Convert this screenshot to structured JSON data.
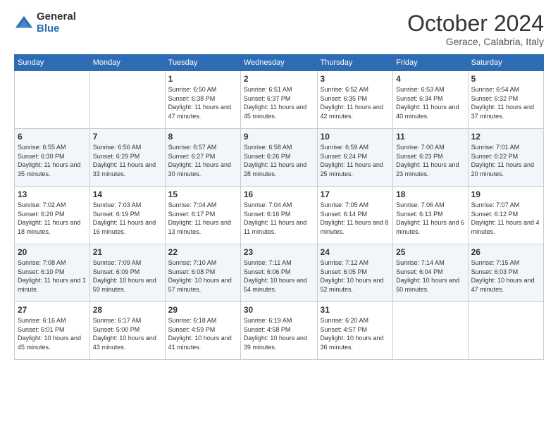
{
  "logo": {
    "general": "General",
    "blue": "Blue"
  },
  "header": {
    "month": "October 2024",
    "location": "Gerace, Calabria, Italy"
  },
  "weekdays": [
    "Sunday",
    "Monday",
    "Tuesday",
    "Wednesday",
    "Thursday",
    "Friday",
    "Saturday"
  ],
  "weeks": [
    [
      {
        "day": "",
        "sunrise": "",
        "sunset": "",
        "daylight": ""
      },
      {
        "day": "",
        "sunrise": "",
        "sunset": "",
        "daylight": ""
      },
      {
        "day": "1",
        "sunrise": "Sunrise: 6:50 AM",
        "sunset": "Sunset: 6:38 PM",
        "daylight": "Daylight: 11 hours and 47 minutes."
      },
      {
        "day": "2",
        "sunrise": "Sunrise: 6:51 AM",
        "sunset": "Sunset: 6:37 PM",
        "daylight": "Daylight: 11 hours and 45 minutes."
      },
      {
        "day": "3",
        "sunrise": "Sunrise: 6:52 AM",
        "sunset": "Sunset: 6:35 PM",
        "daylight": "Daylight: 11 hours and 42 minutes."
      },
      {
        "day": "4",
        "sunrise": "Sunrise: 6:53 AM",
        "sunset": "Sunset: 6:34 PM",
        "daylight": "Daylight: 11 hours and 40 minutes."
      },
      {
        "day": "5",
        "sunrise": "Sunrise: 6:54 AM",
        "sunset": "Sunset: 6:32 PM",
        "daylight": "Daylight: 11 hours and 37 minutes."
      }
    ],
    [
      {
        "day": "6",
        "sunrise": "Sunrise: 6:55 AM",
        "sunset": "Sunset: 6:30 PM",
        "daylight": "Daylight: 11 hours and 35 minutes."
      },
      {
        "day": "7",
        "sunrise": "Sunrise: 6:56 AM",
        "sunset": "Sunset: 6:29 PM",
        "daylight": "Daylight: 11 hours and 33 minutes."
      },
      {
        "day": "8",
        "sunrise": "Sunrise: 6:57 AM",
        "sunset": "Sunset: 6:27 PM",
        "daylight": "Daylight: 11 hours and 30 minutes."
      },
      {
        "day": "9",
        "sunrise": "Sunrise: 6:58 AM",
        "sunset": "Sunset: 6:26 PM",
        "daylight": "Daylight: 11 hours and 28 minutes."
      },
      {
        "day": "10",
        "sunrise": "Sunrise: 6:59 AM",
        "sunset": "Sunset: 6:24 PM",
        "daylight": "Daylight: 11 hours and 25 minutes."
      },
      {
        "day": "11",
        "sunrise": "Sunrise: 7:00 AM",
        "sunset": "Sunset: 6:23 PM",
        "daylight": "Daylight: 11 hours and 23 minutes."
      },
      {
        "day": "12",
        "sunrise": "Sunrise: 7:01 AM",
        "sunset": "Sunset: 6:22 PM",
        "daylight": "Daylight: 11 hours and 20 minutes."
      }
    ],
    [
      {
        "day": "13",
        "sunrise": "Sunrise: 7:02 AM",
        "sunset": "Sunset: 6:20 PM",
        "daylight": "Daylight: 11 hours and 18 minutes."
      },
      {
        "day": "14",
        "sunrise": "Sunrise: 7:03 AM",
        "sunset": "Sunset: 6:19 PM",
        "daylight": "Daylight: 11 hours and 16 minutes."
      },
      {
        "day": "15",
        "sunrise": "Sunrise: 7:04 AM",
        "sunset": "Sunset: 6:17 PM",
        "daylight": "Daylight: 11 hours and 13 minutes."
      },
      {
        "day": "16",
        "sunrise": "Sunrise: 7:04 AM",
        "sunset": "Sunset: 6:16 PM",
        "daylight": "Daylight: 11 hours and 11 minutes."
      },
      {
        "day": "17",
        "sunrise": "Sunrise: 7:05 AM",
        "sunset": "Sunset: 6:14 PM",
        "daylight": "Daylight: 11 hours and 8 minutes."
      },
      {
        "day": "18",
        "sunrise": "Sunrise: 7:06 AM",
        "sunset": "Sunset: 6:13 PM",
        "daylight": "Daylight: 11 hours and 6 minutes."
      },
      {
        "day": "19",
        "sunrise": "Sunrise: 7:07 AM",
        "sunset": "Sunset: 6:12 PM",
        "daylight": "Daylight: 11 hours and 4 minutes."
      }
    ],
    [
      {
        "day": "20",
        "sunrise": "Sunrise: 7:08 AM",
        "sunset": "Sunset: 6:10 PM",
        "daylight": "Daylight: 11 hours and 1 minute."
      },
      {
        "day": "21",
        "sunrise": "Sunrise: 7:09 AM",
        "sunset": "Sunset: 6:09 PM",
        "daylight": "Daylight: 10 hours and 59 minutes."
      },
      {
        "day": "22",
        "sunrise": "Sunrise: 7:10 AM",
        "sunset": "Sunset: 6:08 PM",
        "daylight": "Daylight: 10 hours and 57 minutes."
      },
      {
        "day": "23",
        "sunrise": "Sunrise: 7:11 AM",
        "sunset": "Sunset: 6:06 PM",
        "daylight": "Daylight: 10 hours and 54 minutes."
      },
      {
        "day": "24",
        "sunrise": "Sunrise: 7:12 AM",
        "sunset": "Sunset: 6:05 PM",
        "daylight": "Daylight: 10 hours and 52 minutes."
      },
      {
        "day": "25",
        "sunrise": "Sunrise: 7:14 AM",
        "sunset": "Sunset: 6:04 PM",
        "daylight": "Daylight: 10 hours and 50 minutes."
      },
      {
        "day": "26",
        "sunrise": "Sunrise: 7:15 AM",
        "sunset": "Sunset: 6:03 PM",
        "daylight": "Daylight: 10 hours and 47 minutes."
      }
    ],
    [
      {
        "day": "27",
        "sunrise": "Sunrise: 6:16 AM",
        "sunset": "Sunset: 5:01 PM",
        "daylight": "Daylight: 10 hours and 45 minutes."
      },
      {
        "day": "28",
        "sunrise": "Sunrise: 6:17 AM",
        "sunset": "Sunset: 5:00 PM",
        "daylight": "Daylight: 10 hours and 43 minutes."
      },
      {
        "day": "29",
        "sunrise": "Sunrise: 6:18 AM",
        "sunset": "Sunset: 4:59 PM",
        "daylight": "Daylight: 10 hours and 41 minutes."
      },
      {
        "day": "30",
        "sunrise": "Sunrise: 6:19 AM",
        "sunset": "Sunset: 4:58 PM",
        "daylight": "Daylight: 10 hours and 39 minutes."
      },
      {
        "day": "31",
        "sunrise": "Sunrise: 6:20 AM",
        "sunset": "Sunset: 4:57 PM",
        "daylight": "Daylight: 10 hours and 36 minutes."
      },
      {
        "day": "",
        "sunrise": "",
        "sunset": "",
        "daylight": ""
      },
      {
        "day": "",
        "sunrise": "",
        "sunset": "",
        "daylight": ""
      }
    ]
  ]
}
